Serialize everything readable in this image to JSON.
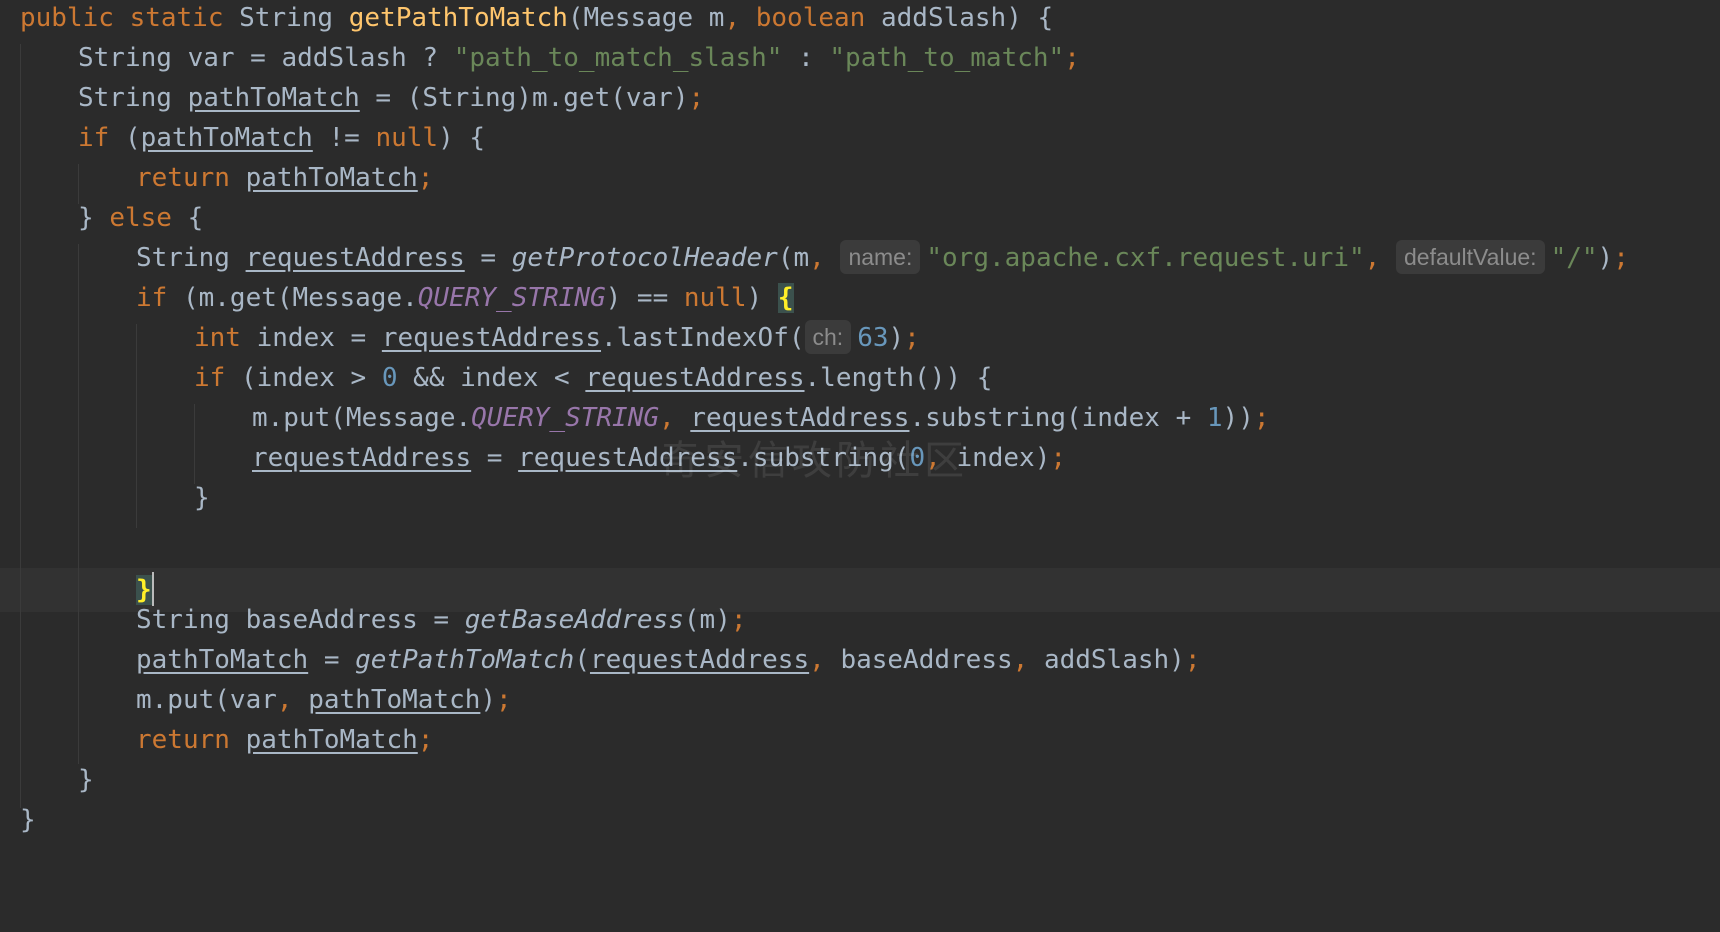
{
  "code": {
    "l1": {
      "kw1": "public static ",
      "type": "String ",
      "fn": "getPathToMatch",
      "p1": "(Message m",
      "comma": ", ",
      "kw2": "boolean ",
      "p2": "addSlash) {"
    },
    "l2": {
      "t1": "String var = addSlash ? ",
      "s1": "\"path_to_match_slash\"",
      "t2": " : ",
      "s2": "\"path_to_match\"",
      "semi": ";"
    },
    "l3": {
      "t1": "String ",
      "v1": "pathToMatch",
      "t2": " = (String)m.get(var)",
      "semi": ";"
    },
    "l4": {
      "kw": "if ",
      "t1": "(",
      "v1": "pathToMatch",
      "t2": " != ",
      "kw2": "null",
      "t3": ") {"
    },
    "l5": {
      "kw": "return ",
      "v1": "pathToMatch",
      "semi": ";"
    },
    "l6": {
      "t1": "} ",
      "kw": "else ",
      "t2": "{"
    },
    "l7": {
      "t1": "String ",
      "v1": "requestAddress",
      "t2": " = ",
      "fn": "getProtocolHeader",
      "t3": "(m",
      "comma": ", ",
      "hint1": "name:",
      "s1": "\"org.apache.cxf.request.uri\"",
      "comma2": ", ",
      "hint2": "defaultValue:",
      "s2": "\"/\"",
      "t4": ")",
      "semi": ";"
    },
    "l8": {
      "kw": "if ",
      "t1": "(m.get(Message.",
      "c1": "QUERY_STRING",
      "t2": ") == ",
      "kw2": "null",
      "t3": ") ",
      "brace": "{"
    },
    "l9": {
      "kw": "int ",
      "t1": "index = ",
      "v1": "requestAddress",
      "t2": ".lastIndexOf(",
      "hint": "ch:",
      "n1": "63",
      "t3": ")",
      "semi": ";"
    },
    "l10": {
      "kw": "if ",
      "t1": "(index > ",
      "n1": "0",
      "t2": " && index < ",
      "v1": "requestAddress",
      "t3": ".length()) {"
    },
    "l11": {
      "t1": "m.put(Message.",
      "c1": "QUERY_STRING",
      "comma": ", ",
      "v1": "requestAddress",
      "t2": ".substring(index + ",
      "n1": "1",
      "t3": "))",
      "semi": ";"
    },
    "l12": {
      "v1": "requestAddress",
      "t1": " = ",
      "v2": "requestAddress",
      "t2": ".substring(",
      "n1": "0",
      "comma": ", ",
      "t3": "index)",
      "semi": ";"
    },
    "l13": {
      "t1": "}"
    },
    "l14": {
      "brace": "}"
    },
    "l16": {
      "t1": "String baseAddress = ",
      "fn": "getBaseAddress",
      "t2": "(m)",
      "semi": ";"
    },
    "l17": {
      "v1": "pathToMatch",
      "t1": " = ",
      "fn": "getPathToMatch",
      "t2": "(",
      "v2": "requestAddress",
      "comma": ", ",
      "t3": "baseAddress",
      "comma2": ", ",
      "t4": "addSlash)",
      "semi": ";"
    },
    "l18": {
      "t1": "m.put(var",
      "comma": ", ",
      "v1": "pathToMatch",
      "t2": ")",
      "semi": ";"
    },
    "l19": {
      "kw": "return ",
      "v1": "pathToMatch",
      "semi": ";"
    },
    "l20": {
      "t1": "}"
    },
    "l21": {
      "t1": "}"
    }
  },
  "watermark": "奇安信攻防社区",
  "colors": {
    "background": "#2b2b2b",
    "text": "#a9b7c6",
    "keyword": "#cc7832",
    "function": "#ffc66d",
    "string": "#6a8759",
    "number": "#6897bb",
    "constant": "#9876aa"
  }
}
